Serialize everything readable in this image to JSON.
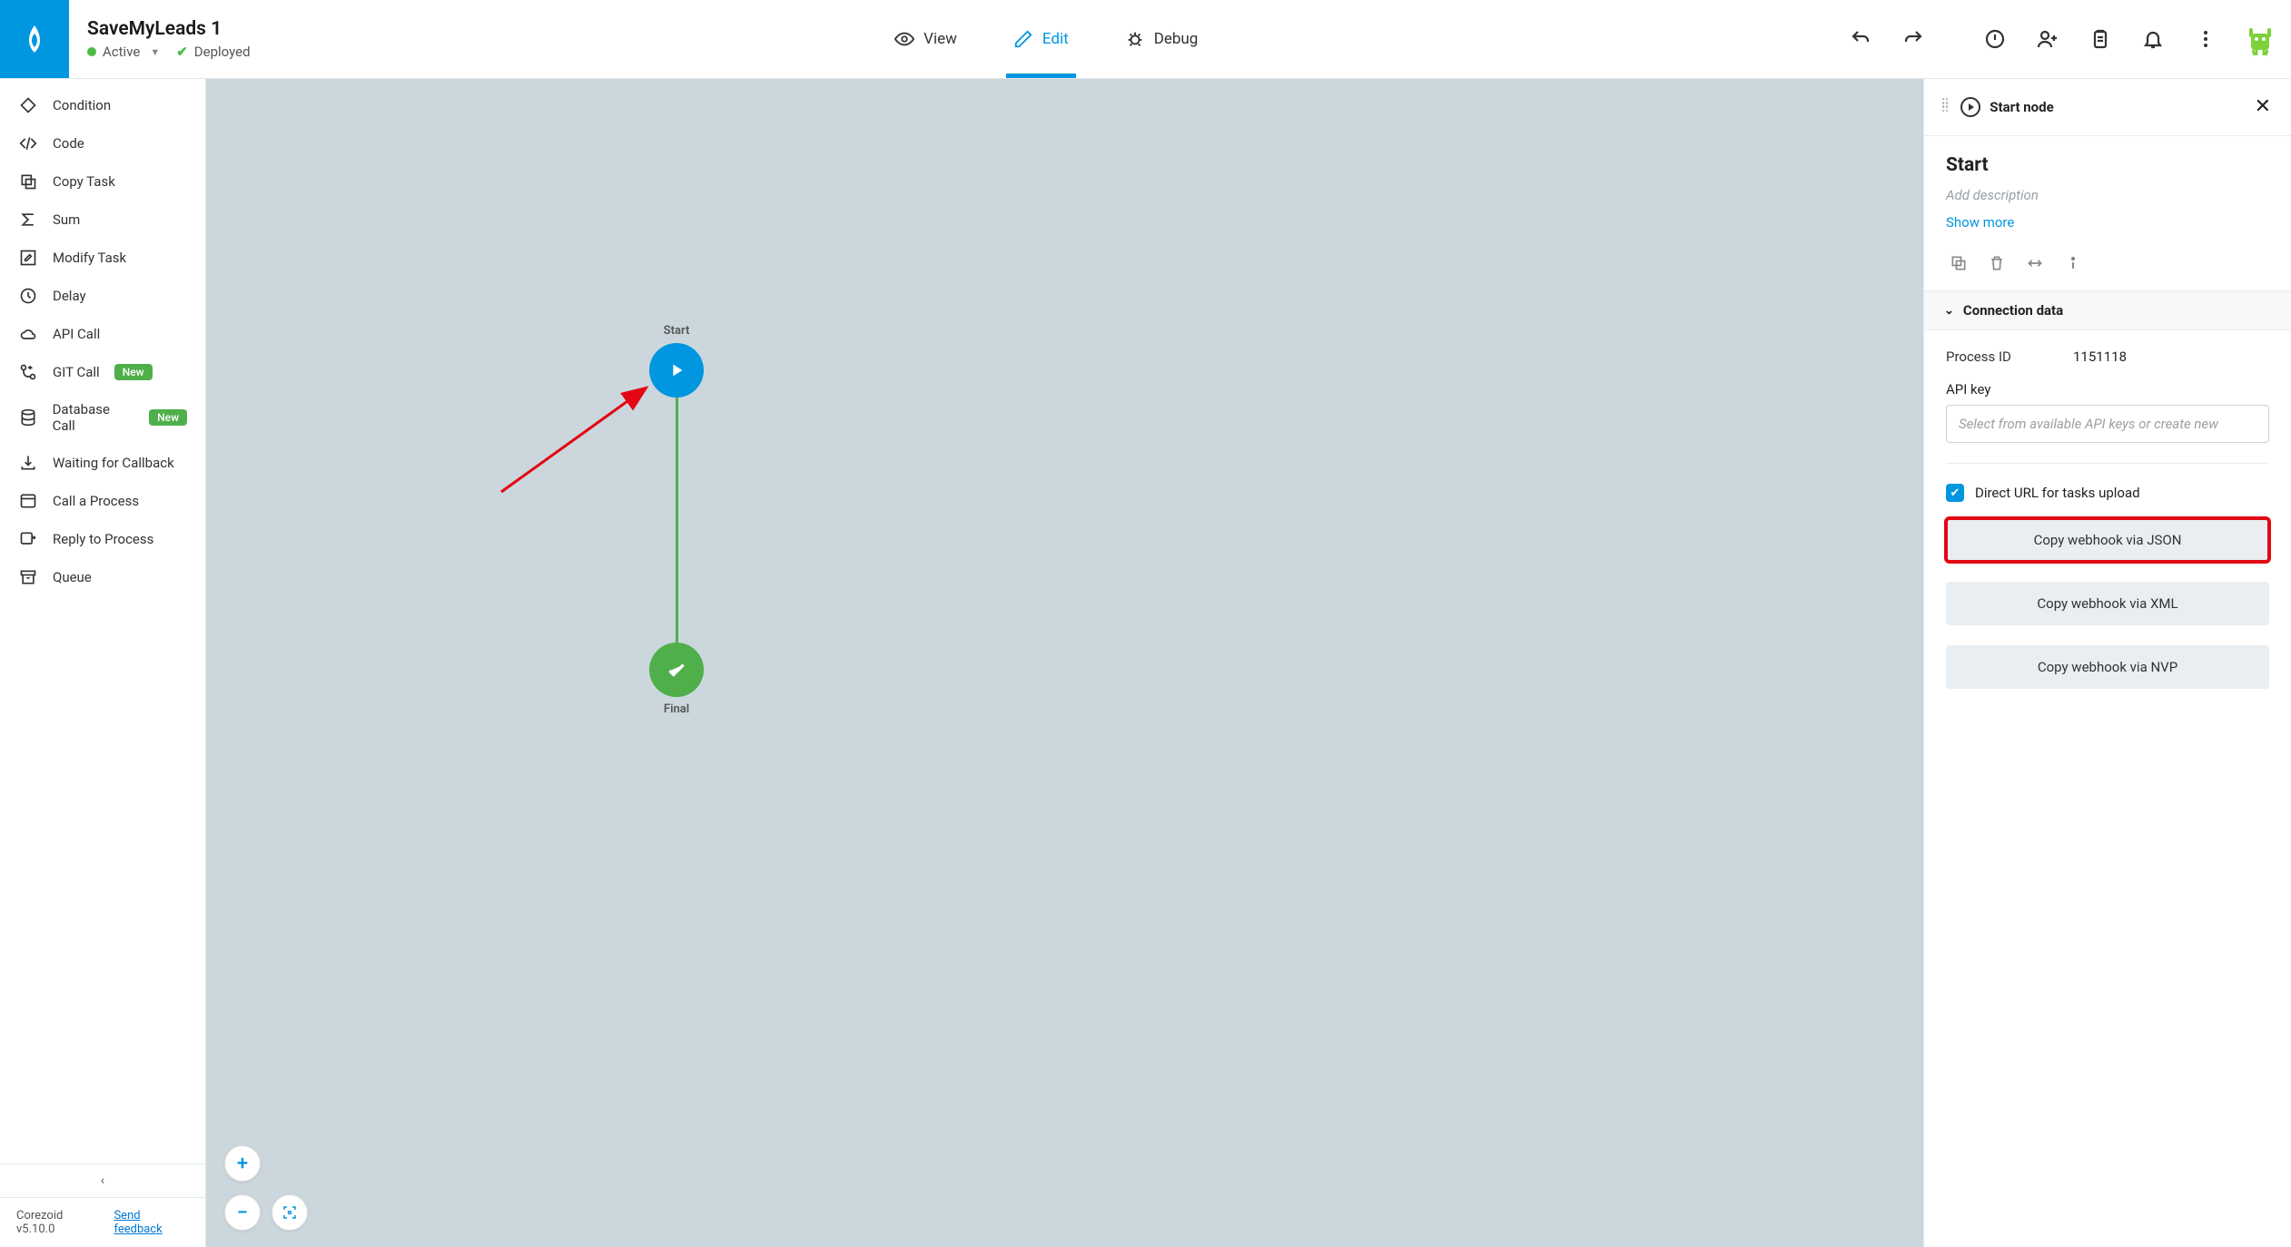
{
  "header": {
    "title": "SaveMyLeads 1",
    "status_active": "Active",
    "status_deployed": "Deployed",
    "tabs": {
      "view": "View",
      "edit": "Edit",
      "debug": "Debug"
    }
  },
  "sidebar": {
    "items": [
      {
        "label": "Condition"
      },
      {
        "label": "Code"
      },
      {
        "label": "Copy Task"
      },
      {
        "label": "Sum"
      },
      {
        "label": "Modify Task"
      },
      {
        "label": "Delay"
      },
      {
        "label": "API Call"
      },
      {
        "label": "GIT Call",
        "new": true
      },
      {
        "label": "Database Call",
        "new": true
      },
      {
        "label": "Waiting for Callback"
      },
      {
        "label": "Call a Process"
      },
      {
        "label": "Reply to Process"
      },
      {
        "label": "Queue"
      }
    ],
    "badge_new": "New",
    "version": "Corezoid v5.10.0",
    "feedback": "Send feedback"
  },
  "canvas": {
    "nodes": {
      "start": "Start",
      "final": "Final"
    }
  },
  "panel": {
    "header_title": "Start node",
    "name": "Start",
    "desc_placeholder": "Add description",
    "show_more": "Show more",
    "section_title": "Connection data",
    "process_id_label": "Process ID",
    "process_id_value": "1151118",
    "api_key_label": "API key",
    "api_key_placeholder": "Select from available API keys or create new",
    "checkbox_label": "Direct URL for tasks upload",
    "btn_json": "Copy webhook via JSON",
    "btn_xml": "Copy webhook via XML",
    "btn_nvp": "Copy webhook via NVP"
  }
}
